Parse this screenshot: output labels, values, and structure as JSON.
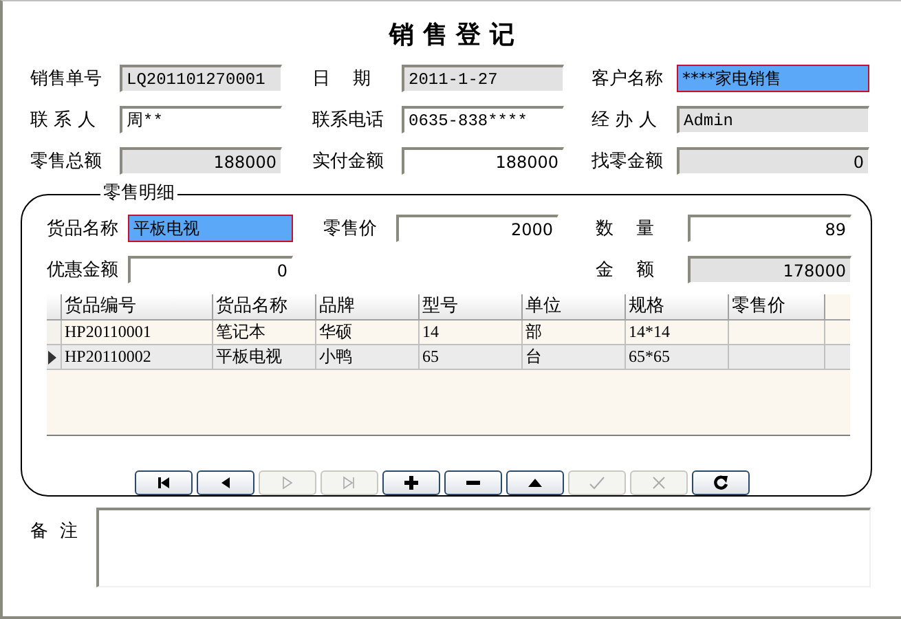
{
  "title": "销 售 登 记",
  "header_fields": [
    {
      "label": "销售单号",
      "value": "LQ201101270001",
      "readonly": true,
      "selected": false,
      "kind": "text"
    },
    {
      "label": "日    期",
      "value": "2011-1-27",
      "readonly": true,
      "selected": false,
      "kind": "text"
    },
    {
      "label": "客户名称",
      "value": "****家电销售",
      "readonly": false,
      "selected": true,
      "kind": "name"
    },
    {
      "label": "联 系 人",
      "value": "周**",
      "readonly": false,
      "selected": false,
      "kind": "text"
    },
    {
      "label": "联系电话",
      "value": "0635-838****",
      "readonly": false,
      "selected": false,
      "kind": "text"
    },
    {
      "label": "经 办 人",
      "value": "Admin",
      "readonly": true,
      "selected": false,
      "kind": "text"
    },
    {
      "label": "零售总额",
      "value": "188000",
      "readonly": true,
      "selected": false,
      "kind": "number"
    },
    {
      "label": "实付金额",
      "value": "188000",
      "readonly": false,
      "selected": false,
      "kind": "number"
    },
    {
      "label": "找零金额",
      "value": "0",
      "readonly": true,
      "selected": false,
      "kind": "number"
    }
  ],
  "detail": {
    "legend": "零售明细",
    "fields": [
      {
        "label": "货品名称",
        "value": "平板电视",
        "readonly": false,
        "selected": true,
        "kind": "name"
      },
      {
        "label": "零售价",
        "value": "2000",
        "readonly": false,
        "selected": false,
        "kind": "number"
      },
      {
        "label": "数    量",
        "value": "89",
        "readonly": false,
        "selected": false,
        "kind": "number"
      },
      {
        "label": "优惠金额",
        "value": "0",
        "readonly": false,
        "selected": false,
        "kind": "number"
      },
      {
        "label": "金    额",
        "value": "178000",
        "readonly": true,
        "selected": false,
        "kind": "number"
      }
    ],
    "table": {
      "columns": [
        "货品编号",
        "货品名称",
        "品牌",
        "型号",
        "单位",
        "规格",
        "零售价"
      ],
      "rows": [
        {
          "cells": [
            "HP20110001",
            "笔记本",
            "华硕",
            "14",
            "部",
            "14*14",
            ""
          ],
          "selected": false
        },
        {
          "cells": [
            "HP20110002",
            "平板电视",
            "小鸭",
            "65",
            "台",
            "65*65",
            ""
          ],
          "selected": true
        }
      ]
    },
    "navigator": [
      {
        "kind": "first",
        "disabled": false
      },
      {
        "kind": "prev",
        "disabled": false
      },
      {
        "kind": "next",
        "disabled": true
      },
      {
        "kind": "last",
        "disabled": true
      },
      {
        "kind": "add",
        "disabled": false
      },
      {
        "kind": "delete",
        "disabled": false
      },
      {
        "kind": "edit",
        "disabled": false
      },
      {
        "kind": "post",
        "disabled": true
      },
      {
        "kind": "cancel",
        "disabled": true
      },
      {
        "kind": "refresh",
        "disabled": false
      }
    ]
  },
  "remark": {
    "label": "备  注"
  }
}
